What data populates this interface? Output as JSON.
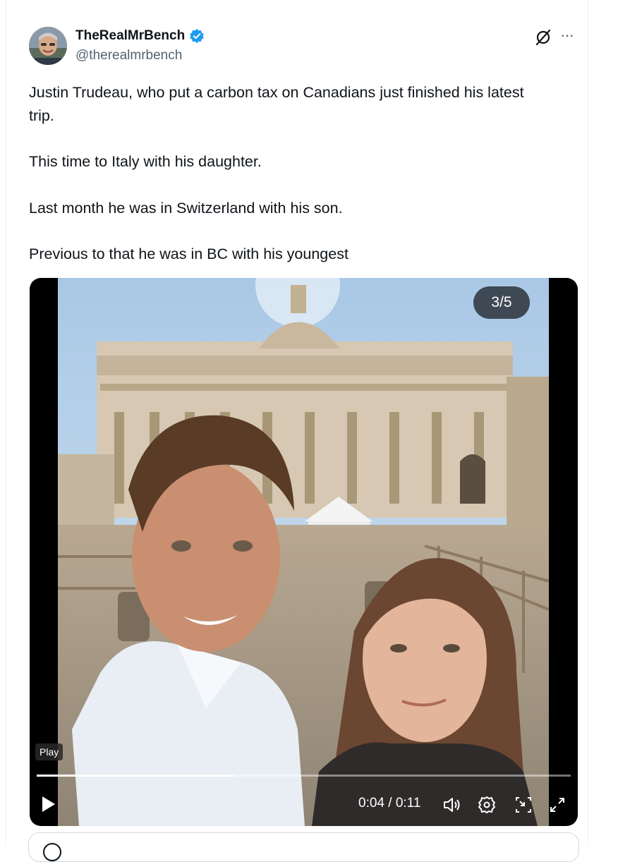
{
  "post": {
    "display_name": "TheRealMrBench",
    "handle": "@therealmrbench",
    "verified": true,
    "text_lines": [
      "Justin Trudeau, who put a carbon tax on Canadians just finished his latest trip.",
      "This time to Italy with his daughter.",
      "Last month he was in Switzerland with his son.",
      "Previous to that he was in BC with his youngest"
    ]
  },
  "media": {
    "counter": "3/5",
    "play_tooltip": "Play",
    "time": "0:04 / 0:11",
    "progress": 0.37
  },
  "icons": [
    "avatar",
    "verified-badge-icon",
    "grok-icon",
    "more-icon",
    "play-icon",
    "volume-icon",
    "settings-icon",
    "dock-icon",
    "fullscreen-icon"
  ],
  "colors": {
    "verified": "#1d9bf0",
    "secondary_text": "#536471",
    "border": "#cfd9de"
  }
}
